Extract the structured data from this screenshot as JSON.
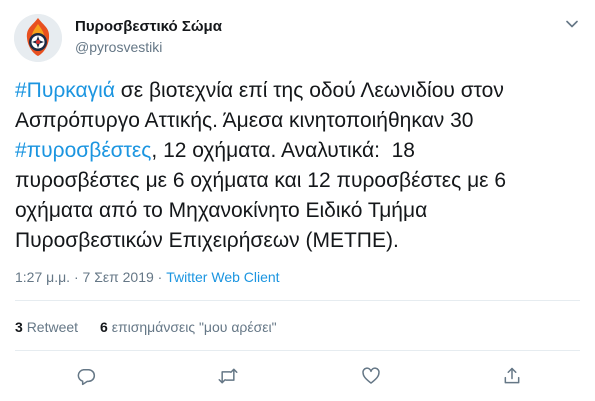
{
  "author": {
    "display_name": "Πυροσβεστικό Σώμα",
    "handle": "@pyrosvestiki"
  },
  "tweet": {
    "lines": [
      [
        {
          "text": "#Πυρκαγιά",
          "hashtag": true
        },
        {
          "text": " σε βιοτεχνία επί της οδού Λεωνιδίου στον",
          "hashtag": false
        }
      ],
      [
        {
          "text": "Ασπρόπυργο Αττικής. Άμεσα κινητοποιήθηκαν 30",
          "hashtag": false
        }
      ],
      [
        {
          "text": "#πυροσβέστες",
          "hashtag": true
        },
        {
          "text": ", 12 οχήματα. Αναλυτικά:  18",
          "hashtag": false
        }
      ],
      [
        {
          "text": "πυροσβέστες με 6 οχήματα και 12 πυροσβέστες με 6",
          "hashtag": false
        }
      ],
      [
        {
          "text": "οχήματα από το Μηχανοκίνητο Ειδικό Τμήμα",
          "hashtag": false
        }
      ],
      [
        {
          "text": "Πυροσβεστικών Επιχειρήσεων (ΜΕΤΠΕ).",
          "hashtag": false
        }
      ]
    ]
  },
  "meta": {
    "time": "1:27 μ.μ.",
    "separator": " · ",
    "date": "7 Σεπ 2019",
    "client": "Twitter Web Client"
  },
  "stats": {
    "retweets_count": "3",
    "retweets_label": "Retweet",
    "likes_count": "6",
    "likes_label": "επισημάνσεις \"μου αρέσει\""
  },
  "actions": {
    "icons": [
      "reply-icon",
      "retweet-icon",
      "like-icon",
      "share-icon"
    ]
  },
  "colors": {
    "hashtag": "#1b95e0",
    "secondary_text": "#657786",
    "icon": "#657786",
    "divider": "#e6ecf0"
  }
}
